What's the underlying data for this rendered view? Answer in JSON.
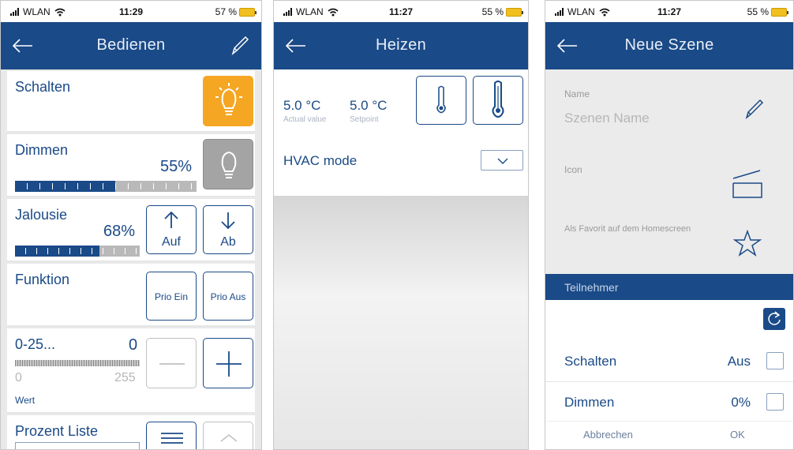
{
  "colors": {
    "navy": "#1a4a87",
    "orange": "#f5a623",
    "grey_tile": "#a4a4a4"
  },
  "screens": [
    {
      "status": {
        "carrier": "WLAN",
        "time": "11:29",
        "battery": "57 %"
      },
      "title": "Bedienen",
      "rows": {
        "schalten": {
          "label": "Schalten",
          "icon": "lightbulb-on-icon"
        },
        "dimmen": {
          "label": "Dimmen",
          "value": "55%",
          "level": 0.55,
          "icon": "lightbulb-off-icon"
        },
        "jalousie": {
          "label": "Jalousie",
          "value": "68%",
          "level": 0.68,
          "up_label": "Auf",
          "down_label": "Ab"
        },
        "funktion": {
          "label": "Funktion",
          "prio_on": "Prio Ein",
          "prio_off": "Prio Aus"
        },
        "wert": {
          "label": "0-25...",
          "current": "0",
          "min": "0",
          "max": "255",
          "caption": "Wert"
        },
        "prozent": {
          "label": "Prozent Liste"
        }
      }
    },
    {
      "status": {
        "carrier": "WLAN",
        "time": "11:27",
        "battery": "55 %"
      },
      "title": "Heizen",
      "actual_value": "5.0 °C",
      "actual_label": "Actual value",
      "setpoint_value": "5.0 °C",
      "setpoint_label": "Setpoint",
      "hvac_label": "HVAC mode"
    },
    {
      "status": {
        "carrier": "WLAN",
        "time": "11:27",
        "battery": "55 %"
      },
      "title": "Neue Szene",
      "name_label": "Name",
      "name_placeholder": "Szenen Name",
      "icon_label": "Icon",
      "favorite_label": "Als Favorit auf dem Homescreen",
      "section_title": "Teilnehmer",
      "rows": [
        {
          "label": "Schalten",
          "value": "Aus"
        },
        {
          "label": "Dimmen",
          "value": "0%"
        }
      ],
      "cancel_label": "Abbrechen",
      "ok_label": "OK"
    }
  ]
}
